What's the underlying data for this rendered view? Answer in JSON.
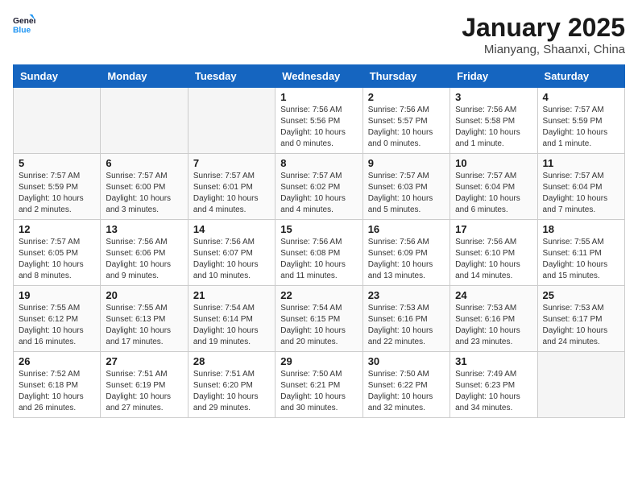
{
  "logo": {
    "line1": "General",
    "line2": "Blue"
  },
  "title": "January 2025",
  "subtitle": "Mianyang, Shaanxi, China",
  "weekdays": [
    "Sunday",
    "Monday",
    "Tuesday",
    "Wednesday",
    "Thursday",
    "Friday",
    "Saturday"
  ],
  "weeks": [
    [
      {
        "day": "",
        "info": ""
      },
      {
        "day": "",
        "info": ""
      },
      {
        "day": "",
        "info": ""
      },
      {
        "day": "1",
        "info": "Sunrise: 7:56 AM\nSunset: 5:56 PM\nDaylight: 10 hours\nand 0 minutes."
      },
      {
        "day": "2",
        "info": "Sunrise: 7:56 AM\nSunset: 5:57 PM\nDaylight: 10 hours\nand 0 minutes."
      },
      {
        "day": "3",
        "info": "Sunrise: 7:56 AM\nSunset: 5:58 PM\nDaylight: 10 hours\nand 1 minute."
      },
      {
        "day": "4",
        "info": "Sunrise: 7:57 AM\nSunset: 5:59 PM\nDaylight: 10 hours\nand 1 minute."
      }
    ],
    [
      {
        "day": "5",
        "info": "Sunrise: 7:57 AM\nSunset: 5:59 PM\nDaylight: 10 hours\nand 2 minutes."
      },
      {
        "day": "6",
        "info": "Sunrise: 7:57 AM\nSunset: 6:00 PM\nDaylight: 10 hours\nand 3 minutes."
      },
      {
        "day": "7",
        "info": "Sunrise: 7:57 AM\nSunset: 6:01 PM\nDaylight: 10 hours\nand 4 minutes."
      },
      {
        "day": "8",
        "info": "Sunrise: 7:57 AM\nSunset: 6:02 PM\nDaylight: 10 hours\nand 4 minutes."
      },
      {
        "day": "9",
        "info": "Sunrise: 7:57 AM\nSunset: 6:03 PM\nDaylight: 10 hours\nand 5 minutes."
      },
      {
        "day": "10",
        "info": "Sunrise: 7:57 AM\nSunset: 6:04 PM\nDaylight: 10 hours\nand 6 minutes."
      },
      {
        "day": "11",
        "info": "Sunrise: 7:57 AM\nSunset: 6:04 PM\nDaylight: 10 hours\nand 7 minutes."
      }
    ],
    [
      {
        "day": "12",
        "info": "Sunrise: 7:57 AM\nSunset: 6:05 PM\nDaylight: 10 hours\nand 8 minutes."
      },
      {
        "day": "13",
        "info": "Sunrise: 7:56 AM\nSunset: 6:06 PM\nDaylight: 10 hours\nand 9 minutes."
      },
      {
        "day": "14",
        "info": "Sunrise: 7:56 AM\nSunset: 6:07 PM\nDaylight: 10 hours\nand 10 minutes."
      },
      {
        "day": "15",
        "info": "Sunrise: 7:56 AM\nSunset: 6:08 PM\nDaylight: 10 hours\nand 11 minutes."
      },
      {
        "day": "16",
        "info": "Sunrise: 7:56 AM\nSunset: 6:09 PM\nDaylight: 10 hours\nand 13 minutes."
      },
      {
        "day": "17",
        "info": "Sunrise: 7:56 AM\nSunset: 6:10 PM\nDaylight: 10 hours\nand 14 minutes."
      },
      {
        "day": "18",
        "info": "Sunrise: 7:55 AM\nSunset: 6:11 PM\nDaylight: 10 hours\nand 15 minutes."
      }
    ],
    [
      {
        "day": "19",
        "info": "Sunrise: 7:55 AM\nSunset: 6:12 PM\nDaylight: 10 hours\nand 16 minutes."
      },
      {
        "day": "20",
        "info": "Sunrise: 7:55 AM\nSunset: 6:13 PM\nDaylight: 10 hours\nand 17 minutes."
      },
      {
        "day": "21",
        "info": "Sunrise: 7:54 AM\nSunset: 6:14 PM\nDaylight: 10 hours\nand 19 minutes."
      },
      {
        "day": "22",
        "info": "Sunrise: 7:54 AM\nSunset: 6:15 PM\nDaylight: 10 hours\nand 20 minutes."
      },
      {
        "day": "23",
        "info": "Sunrise: 7:53 AM\nSunset: 6:16 PM\nDaylight: 10 hours\nand 22 minutes."
      },
      {
        "day": "24",
        "info": "Sunrise: 7:53 AM\nSunset: 6:16 PM\nDaylight: 10 hours\nand 23 minutes."
      },
      {
        "day": "25",
        "info": "Sunrise: 7:53 AM\nSunset: 6:17 PM\nDaylight: 10 hours\nand 24 minutes."
      }
    ],
    [
      {
        "day": "26",
        "info": "Sunrise: 7:52 AM\nSunset: 6:18 PM\nDaylight: 10 hours\nand 26 minutes."
      },
      {
        "day": "27",
        "info": "Sunrise: 7:51 AM\nSunset: 6:19 PM\nDaylight: 10 hours\nand 27 minutes."
      },
      {
        "day": "28",
        "info": "Sunrise: 7:51 AM\nSunset: 6:20 PM\nDaylight: 10 hours\nand 29 minutes."
      },
      {
        "day": "29",
        "info": "Sunrise: 7:50 AM\nSunset: 6:21 PM\nDaylight: 10 hours\nand 30 minutes."
      },
      {
        "day": "30",
        "info": "Sunrise: 7:50 AM\nSunset: 6:22 PM\nDaylight: 10 hours\nand 32 minutes."
      },
      {
        "day": "31",
        "info": "Sunrise: 7:49 AM\nSunset: 6:23 PM\nDaylight: 10 hours\nand 34 minutes."
      },
      {
        "day": "",
        "info": ""
      }
    ]
  ]
}
